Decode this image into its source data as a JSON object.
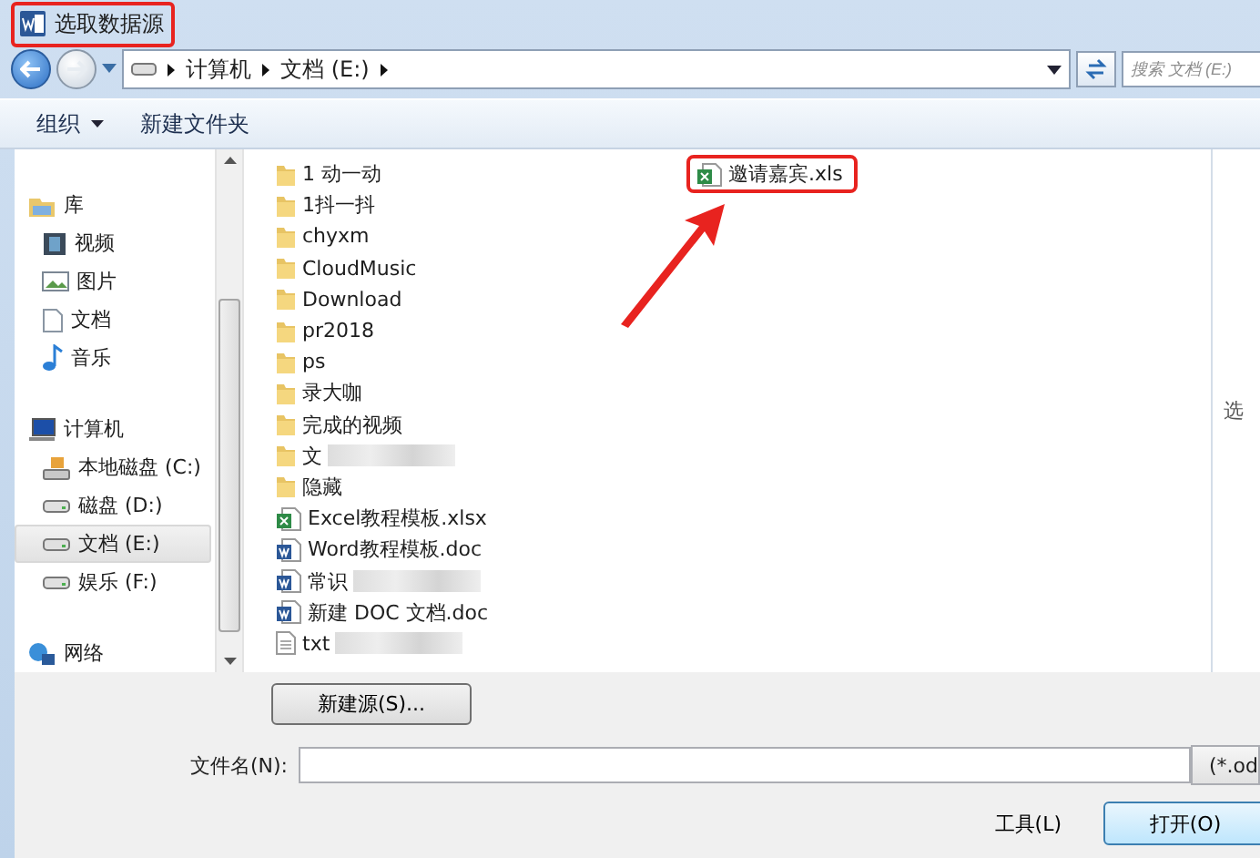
{
  "window": {
    "title": "选取数据源",
    "highlighted": true
  },
  "address": {
    "path": [
      "计算机",
      "文档 (E:)"
    ]
  },
  "search": {
    "placeholder": "搜索 文档 (E:)"
  },
  "toolbar": [
    {
      "label": "组织",
      "kind": "menu"
    },
    {
      "label": "新建文件夹",
      "kind": "button"
    }
  ],
  "nav": [
    {
      "label": "库",
      "kind": "library",
      "selected": false,
      "children": [
        {
          "label": "视频",
          "kind": "video",
          "selected": false
        },
        {
          "label": "图片",
          "kind": "picture",
          "selected": false
        },
        {
          "label": "文档",
          "kind": "document",
          "selected": false
        },
        {
          "label": "音乐",
          "kind": "music",
          "selected": false
        }
      ]
    },
    {
      "label": "计算机",
      "kind": "computer",
      "selected": false,
      "children": [
        {
          "label": "本地磁盘 (C:)",
          "kind": "system",
          "selected": false
        },
        {
          "label": "磁盘 (D:)",
          "kind": "drive",
          "selected": false
        },
        {
          "label": "文档 (E:)",
          "kind": "drive",
          "selected": true
        },
        {
          "label": "娱乐 (F:)",
          "kind": "drive",
          "selected": false
        }
      ]
    },
    {
      "label": "网络",
      "kind": "network",
      "selected": false
    }
  ],
  "files": [
    {
      "name": "1 动一动",
      "kind": "folder",
      "highlighted": false
    },
    {
      "name": "1抖一抖",
      "kind": "folder",
      "highlighted": false
    },
    {
      "name": "chyxm",
      "kind": "folder",
      "highlighted": false
    },
    {
      "name": "CloudMusic",
      "kind": "folder",
      "highlighted": false
    },
    {
      "name": "Download",
      "kind": "folder",
      "highlighted": false
    },
    {
      "name": "pr2018",
      "kind": "folder",
      "highlighted": false
    },
    {
      "name": "ps",
      "kind": "folder",
      "highlighted": false
    },
    {
      "name": "录大咖",
      "kind": "folder",
      "highlighted": false
    },
    {
      "name": "完成的视频",
      "kind": "folder",
      "highlighted": false
    },
    {
      "name": "文",
      "kind": "folder",
      "highlighted": false,
      "blurred": true
    },
    {
      "name": "隐藏",
      "kind": "folder",
      "highlighted": false
    },
    {
      "name": "Excel教程模板.xlsx",
      "kind": "excel",
      "highlighted": false
    },
    {
      "name": "Word教程模板.doc",
      "kind": "word",
      "highlighted": false
    },
    {
      "name": "常识",
      "kind": "word",
      "highlighted": false,
      "blurred": true
    },
    {
      "name": "新建 DOC 文档.doc",
      "kind": "word",
      "highlighted": false
    },
    {
      "name": "txt",
      "kind": "text",
      "highlighted": false,
      "blurred": true
    },
    {
      "name": "邀请嘉宾.xls",
      "kind": "excel",
      "highlighted": true
    }
  ],
  "preview": {
    "text": "选"
  },
  "new_source_button": "新建源(S)...",
  "filename": {
    "label": "文件名(N):"
  },
  "file_type": "(*.od",
  "buttons": [
    "工具(L)",
    "打开(O)"
  ]
}
